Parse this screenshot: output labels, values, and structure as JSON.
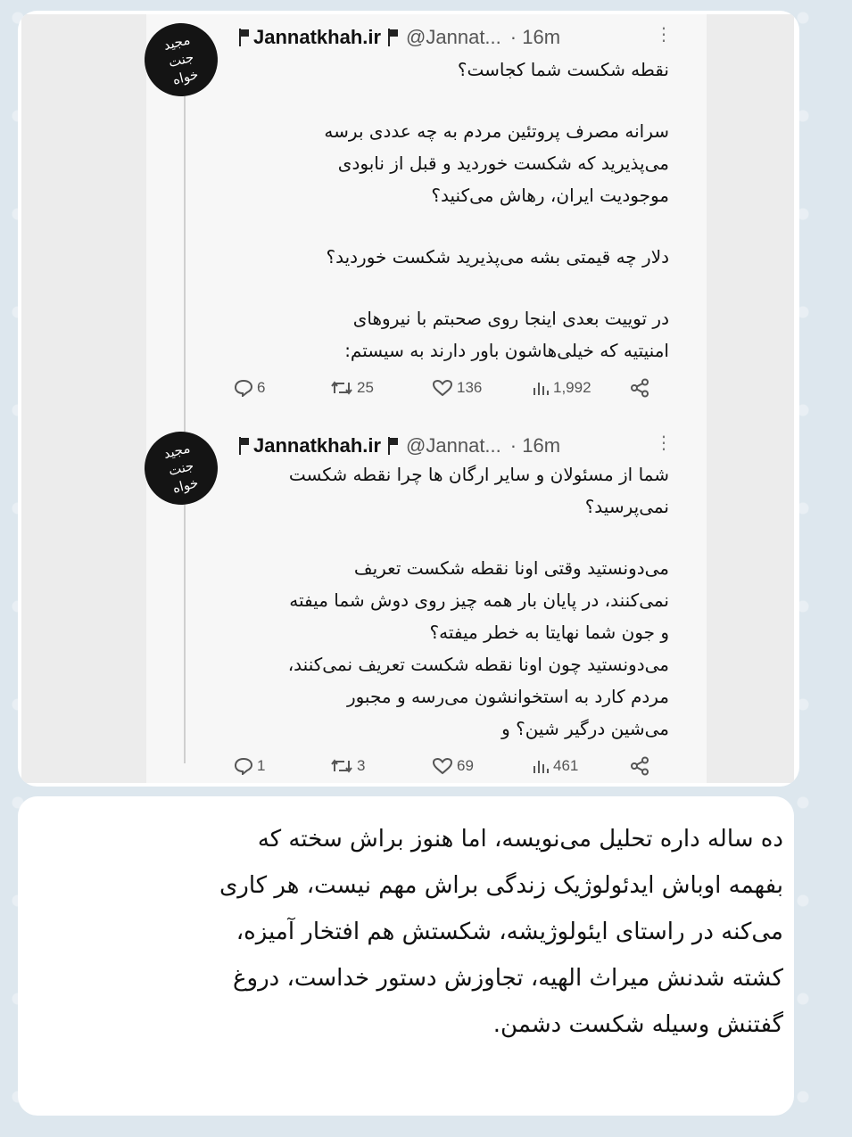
{
  "tweets": [
    {
      "name": "Jannatkhah.ir",
      "handle": "@Jannat...",
      "time": "· 16m",
      "avatar_text": "مجید جنت خواه",
      "paragraphs": [
        [
          "نقطه شکست شما کجاست؟"
        ],
        [
          "سرانه مصرف پروتئین مردم به چه عددی برسه",
          "می‌پذیرید که شکست خوردید و قبل از نابودی",
          "موجودیت ایران، رهاش می‌کنید؟"
        ],
        [
          "دلار چه قیمتی بشه می‌پذیرید شکست خوردید؟"
        ],
        [
          "در توییت بعدی اینجا روی صحبتم با نیروهای",
          "امنیتیه که خیلی‌هاشون باور دارند به سیستم:"
        ]
      ],
      "replies": "6",
      "retweets": "25",
      "likes": "136",
      "views": "1,992"
    },
    {
      "name": "Jannatkhah.ir",
      "handle": "@Jannat...",
      "time": "· 16m",
      "avatar_text": "مجید جنت خواه",
      "paragraphs": [
        [
          "شما از مسئولان و سایر ارگان ها چرا نقطه شکست",
          "نمی‌پرسید؟"
        ],
        [
          "می‌دونستید وقتی اونا نقطه شکست تعریف",
          "نمی‌کنند، در پایان بار همه چیز روی دوش شما میفته",
          "و جون شما نهایتا به خطر میفته؟",
          "می‌دونستید چون اونا نقطه شکست تعریف نمی‌کنند،",
          "مردم کارد به استخوانشون می‌رسه و مجبور",
          "می‌شین درگیر شین؟ و"
        ]
      ],
      "replies": "1",
      "retweets": "3",
      "likes": "69",
      "views": "461"
    }
  ],
  "caption": {
    "lines": [
      "ده ساله داره تحلیل می‌نویسه، اما هنوز براش سخته که",
      "بفهمه اوباش ایدئولوژیک زندگی براش مهم نیست، هر کاری",
      "می‌کنه در راستای ایئولوژیشه، شکستش هم افتخار آمیزه،",
      "کشته شدنش میراث الهیه، تجاوزش دستور خداست، دروغ",
      "گفتنش وسیله شکست دشمن."
    ]
  },
  "icons": {
    "reply": "comment-bubble-icon",
    "retweet": "retweet-arrows-icon",
    "like": "heart-icon",
    "views": "bar-chart-icon",
    "share": "share-icon",
    "more": "vertical-dots-icon",
    "flag": "flag-icon"
  }
}
